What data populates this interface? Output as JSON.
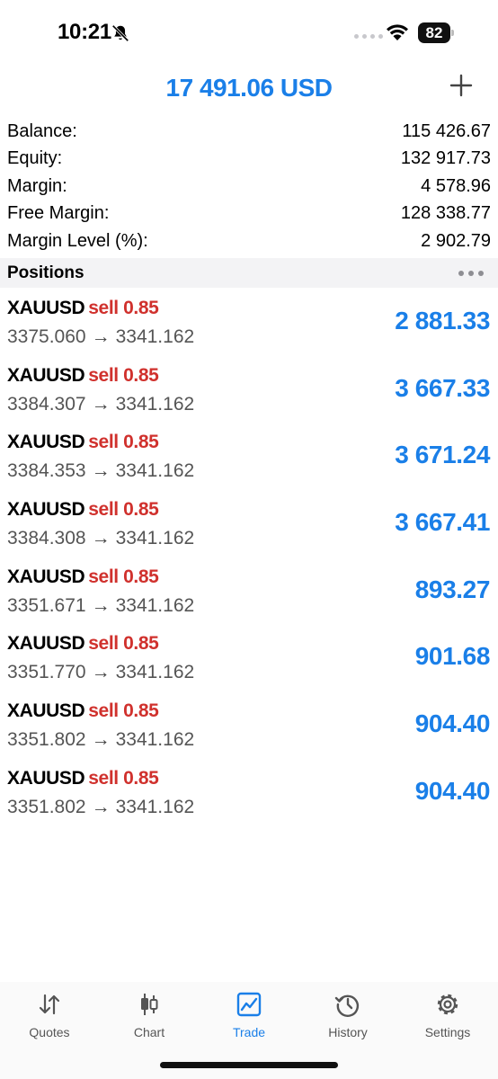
{
  "status_bar": {
    "time": "10:21",
    "battery": "82"
  },
  "header": {
    "title": "17 491.06 USD"
  },
  "summary": [
    {
      "label": "Balance:",
      "value": "115 426.67"
    },
    {
      "label": "Equity:",
      "value": "132 917.73"
    },
    {
      "label": "Margin:",
      "value": "4 578.96"
    },
    {
      "label": "Free Margin:",
      "value": "128 338.77"
    },
    {
      "label": "Margin Level (%):",
      "value": "2 902.79"
    }
  ],
  "positions_section": {
    "title": "Positions"
  },
  "positions": [
    {
      "symbol": "XAUUSD",
      "side": "sell 0.85",
      "open": "3375.060",
      "current": "3341.162",
      "profit": "2 881.33"
    },
    {
      "symbol": "XAUUSD",
      "side": "sell 0.85",
      "open": "3384.307",
      "current": "3341.162",
      "profit": "3 667.33"
    },
    {
      "symbol": "XAUUSD",
      "side": "sell 0.85",
      "open": "3384.353",
      "current": "3341.162",
      "profit": "3 671.24"
    },
    {
      "symbol": "XAUUSD",
      "side": "sell 0.85",
      "open": "3384.308",
      "current": "3341.162",
      "profit": "3 667.41"
    },
    {
      "symbol": "XAUUSD",
      "side": "sell 0.85",
      "open": "3351.671",
      "current": "3341.162",
      "profit": "893.27"
    },
    {
      "symbol": "XAUUSD",
      "side": "sell 0.85",
      "open": "3351.770",
      "current": "3341.162",
      "profit": "901.68"
    },
    {
      "symbol": "XAUUSD",
      "side": "sell 0.85",
      "open": "3351.802",
      "current": "3341.162",
      "profit": "904.40"
    },
    {
      "symbol": "XAUUSD",
      "side": "sell 0.85",
      "open": "3351.802",
      "current": "3341.162",
      "profit": "904.40"
    }
  ],
  "arrow_glyph": "→",
  "tabs": [
    {
      "label": "Quotes",
      "icon": "quotes-icon"
    },
    {
      "label": "Chart",
      "icon": "chart-icon"
    },
    {
      "label": "Trade",
      "icon": "trade-icon",
      "active": true
    },
    {
      "label": "History",
      "icon": "history-icon"
    },
    {
      "label": "Settings",
      "icon": "settings-icon"
    }
  ],
  "colors": {
    "accent": "#1a7fe8",
    "sell": "#d0312d",
    "section_bg": "#f3f3f5"
  }
}
